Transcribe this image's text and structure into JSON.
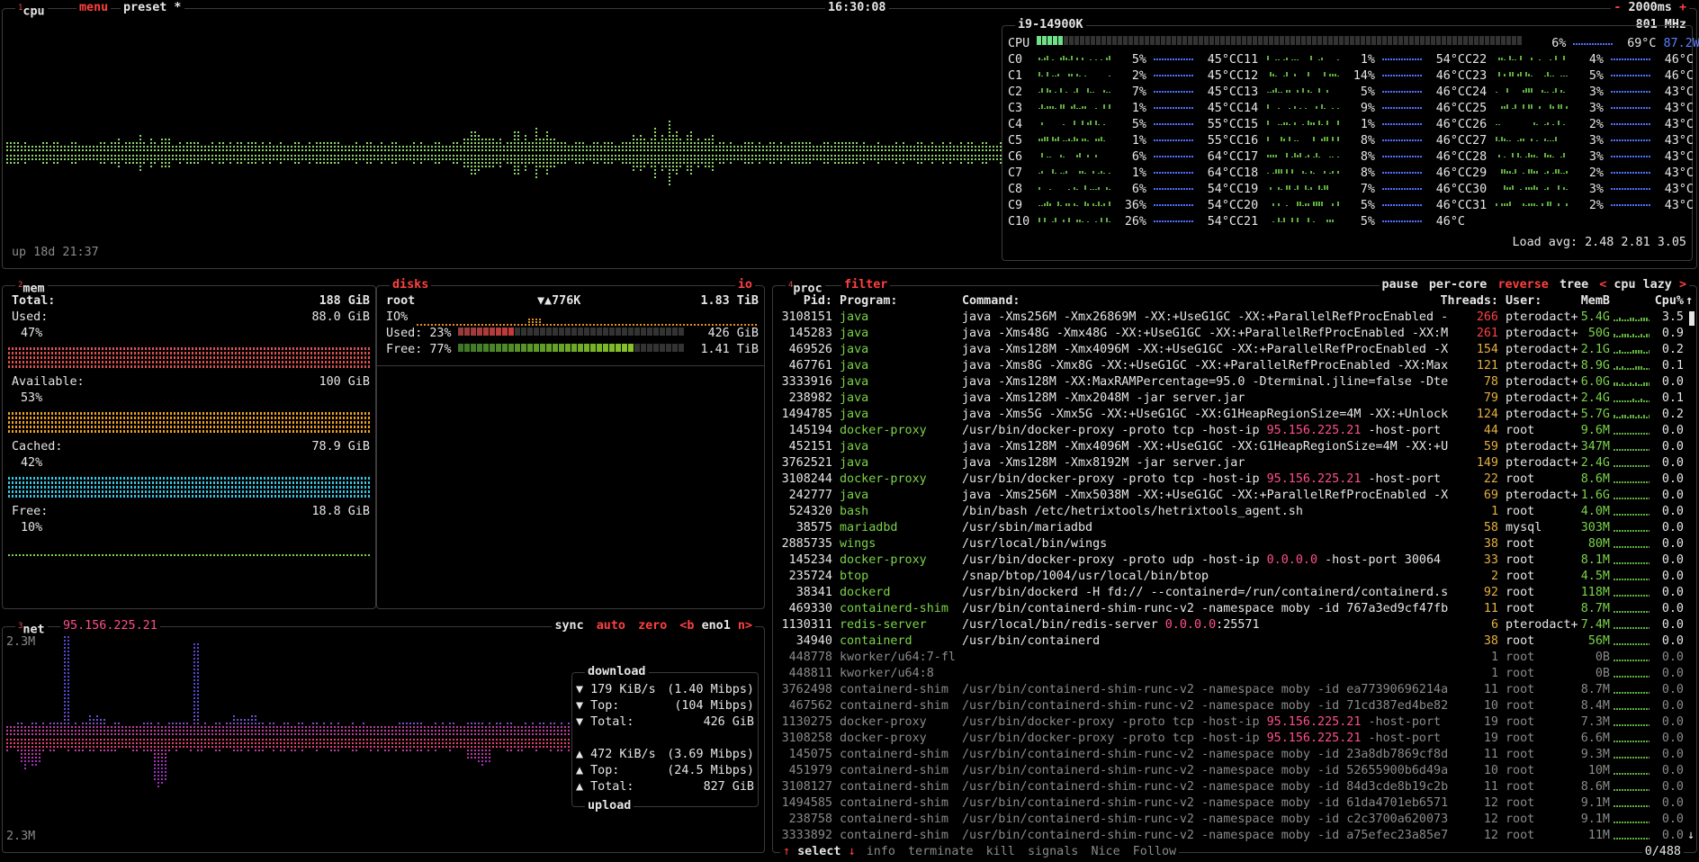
{
  "cpu": {
    "tab_num": "1",
    "tab_label": "cpu",
    "menu_label": "menu",
    "preset_label": "preset *",
    "clock": "16:30:08",
    "interval": "2000ms",
    "interval_minus": "-",
    "interval_plus": "+",
    "uptime": "up 18d 21:37",
    "model": "i9-14900K",
    "freq": "801 MHz",
    "total_label": "CPU",
    "total_pct": "6%",
    "total_temp": "69°C",
    "power": "87.2W",
    "load_avg_label": "Load avg:",
    "load_avg": "2.48 2.81 3.05",
    "cores": [
      {
        "n": "C0",
        "p": "5%",
        "t": "45°C"
      },
      {
        "n": "C1",
        "p": "2%",
        "t": "45°C"
      },
      {
        "n": "C2",
        "p": "7%",
        "t": "45°C"
      },
      {
        "n": "C3",
        "p": "1%",
        "t": "45°C"
      },
      {
        "n": "C4",
        "p": "5%",
        "t": "55°C"
      },
      {
        "n": "C5",
        "p": "1%",
        "t": "55°C"
      },
      {
        "n": "C6",
        "p": "6%",
        "t": "64°C"
      },
      {
        "n": "C7",
        "p": "1%",
        "t": "64°C"
      },
      {
        "n": "C8",
        "p": "6%",
        "t": "54°C"
      },
      {
        "n": "C9",
        "p": "36%",
        "t": "54°C"
      },
      {
        "n": "C10",
        "p": "26%",
        "t": "54°C"
      },
      {
        "n": "C11",
        "p": "1%",
        "t": "54°C"
      },
      {
        "n": "C12",
        "p": "14%",
        "t": "46°C"
      },
      {
        "n": "C13",
        "p": "5%",
        "t": "46°C"
      },
      {
        "n": "C14",
        "p": "9%",
        "t": "46°C"
      },
      {
        "n": "C15",
        "p": "1%",
        "t": "46°C"
      },
      {
        "n": "C16",
        "p": "8%",
        "t": "46°C"
      },
      {
        "n": "C17",
        "p": "8%",
        "t": "46°C"
      },
      {
        "n": "C18",
        "p": "8%",
        "t": "46°C"
      },
      {
        "n": "C19",
        "p": "7%",
        "t": "46°C"
      },
      {
        "n": "C20",
        "p": "5%",
        "t": "46°C"
      },
      {
        "n": "C21",
        "p": "5%",
        "t": "46°C"
      },
      {
        "n": "C22",
        "p": "4%",
        "t": "46°C"
      },
      {
        "n": "C23",
        "p": "5%",
        "t": "46°C"
      },
      {
        "n": "C24",
        "p": "3%",
        "t": "43°C"
      },
      {
        "n": "C25",
        "p": "3%",
        "t": "43°C"
      },
      {
        "n": "C26",
        "p": "2%",
        "t": "43°C"
      },
      {
        "n": "C27",
        "p": "3%",
        "t": "43°C"
      },
      {
        "n": "C28",
        "p": "3%",
        "t": "43°C"
      },
      {
        "n": "C29",
        "p": "2%",
        "t": "43°C"
      },
      {
        "n": "C30",
        "p": "3%",
        "t": "43°C"
      },
      {
        "n": "C31",
        "p": "2%",
        "t": "43°C"
      }
    ]
  },
  "mem": {
    "tab_num": "2",
    "tab_label": "mem",
    "total_label": "Total:",
    "total": "188 GiB",
    "used_label": "Used:",
    "used": "88.0 GiB",
    "used_pct": "47%",
    "avail_label": "Available:",
    "avail": "100 GiB",
    "avail_pct": "53%",
    "cached_label": "Cached:",
    "cached": "78.9 GiB",
    "cached_pct": "42%",
    "free_label": "Free:",
    "free": "18.8 GiB",
    "free_pct": "10%"
  },
  "disks": {
    "tab_label": "disks",
    "io_label": "io",
    "name": "root",
    "io_rate": "▼▲776K",
    "size": "1.83 TiB",
    "io_pct_label": "IO%",
    "used_label": "Used: 23%",
    "used": "426 GiB",
    "free_label": "Free: 77%",
    "free": "1.41 TiB",
    "used_frac": 0.23,
    "free_frac": 0.77
  },
  "net": {
    "tab_num": "3",
    "tab_label": "net",
    "ip": "95.156.225.21",
    "sync": "sync",
    "auto": "auto",
    "zero": "zero",
    "iface_prev": "<b",
    "iface": "eno1",
    "iface_next": "n>",
    "scale_top": "2.3M",
    "scale_bottom": "2.3M",
    "download_label": "download",
    "dl_rate": "179 KiB/s",
    "dl_mbps": "(1.40 Mibps)",
    "dl_top_label": "Top:",
    "dl_top": "(104 Mibps)",
    "dl_total_label": "Total:",
    "dl_total": "426 GiB",
    "ul_rate": "472 KiB/s",
    "ul_mbps": "(3.69 Mibps)",
    "ul_top_label": "Top:",
    "ul_top": "(24.5 Mibps)",
    "ul_total_label": "Total:",
    "ul_total": "827 GiB",
    "upload_label": "upload",
    "down_arrow": "▼",
    "up_arrow": "▲"
  },
  "proc": {
    "tab_num": "4",
    "tab_label": "proc",
    "filter_label": "filter",
    "pause_label": "pause",
    "percore_label": "per-core",
    "reverse_label": "reverse",
    "tree_label": "tree",
    "sort_prev": "<",
    "sort_label": "cpu lazy",
    "sort_next": ">",
    "headers": {
      "pid": "Pid:",
      "program": "Program:",
      "command": "Command:",
      "threads": "Threads:",
      "user": "User:",
      "mem": "MemB",
      "cpu": "Cpu%"
    },
    "rows": [
      {
        "pid": "3108151",
        "prog": "java",
        "cmd": "java -Xms256M -Xmx26869M -XX:+UseG1GC -XX:+ParallelRefProcEnabled -",
        "thr": "266",
        "user": "pterodact+",
        "mem": "5.4G",
        "cpu": "3.5",
        "hot": true
      },
      {
        "pid": "145283",
        "prog": "java",
        "cmd": "java -Xms48G -Xmx48G -XX:+UseG1GC -XX:+ParallelRefProcEnabled -XX:M",
        "thr": "261",
        "user": "pterodact+",
        "mem": "50G",
        "cpu": "0.9",
        "hot": true
      },
      {
        "pid": "469526",
        "prog": "java",
        "cmd": "java -Xms128M -Xmx4096M -XX:+UseG1GC -XX:+ParallelRefProcEnabled -X",
        "thr": "154",
        "user": "pterodact+",
        "mem": "2.1G",
        "cpu": "0.2"
      },
      {
        "pid": "467761",
        "prog": "java",
        "cmd": "java -Xms8G -Xmx8G -XX:+UseG1GC -XX:+ParallelRefProcEnabled -XX:Max",
        "thr": "121",
        "user": "pterodact+",
        "mem": "8.9G",
        "cpu": "0.1"
      },
      {
        "pid": "3333916",
        "prog": "java",
        "cmd": "java -Xms128M -XX:MaxRAMPercentage=95.0 -Dterminal.jline=false -Dte",
        "thr": "78",
        "user": "pterodact+",
        "mem": "6.0G",
        "cpu": "0.0"
      },
      {
        "pid": "238982",
        "prog": "java",
        "cmd": "java -Xms128M -Xmx2048M -jar server.jar",
        "thr": "79",
        "user": "pterodact+",
        "mem": "2.4G",
        "cpu": "0.1"
      },
      {
        "pid": "1494785",
        "prog": "java",
        "cmd": "java -Xms5G -Xmx5G -XX:+UseG1GC -XX:G1HeapRegionSize=4M -XX:+Unlock",
        "thr": "124",
        "user": "pterodact+",
        "mem": "5.7G",
        "cpu": "0.2"
      },
      {
        "pid": "145194",
        "prog": "docker-proxy",
        "cmd": "/usr/bin/docker-proxy -proto tcp -host-ip ",
        "ip": "95.156.225.21",
        "cmd2": " -host-port",
        "thr": "44",
        "user": "root",
        "mem": "9.6M",
        "cpu": "0.0"
      },
      {
        "pid": "452151",
        "prog": "java",
        "cmd": "java -Xms128M -Xmx4096M -XX:+UseG1GC -XX:G1HeapRegionSize=4M -XX:+U",
        "thr": "59",
        "user": "pterodact+",
        "mem": "347M",
        "cpu": "0.0"
      },
      {
        "pid": "3762521",
        "prog": "java",
        "cmd": "java -Xms128M -Xmx8192M -jar server.jar",
        "thr": "149",
        "user": "pterodact+",
        "mem": "2.4G",
        "cpu": "0.0"
      },
      {
        "pid": "3108244",
        "prog": "docker-proxy",
        "cmd": "/usr/bin/docker-proxy -proto tcp -host-ip ",
        "ip": "95.156.225.21",
        "cmd2": " -host-port",
        "thr": "22",
        "user": "root",
        "mem": "8.6M",
        "cpu": "0.0"
      },
      {
        "pid": "242777",
        "prog": "java",
        "cmd": "java -Xms256M -Xmx5038M -XX:+UseG1GC -XX:+ParallelRefProcEnabled -X",
        "thr": "69",
        "user": "pterodact+",
        "mem": "1.6G",
        "cpu": "0.0"
      },
      {
        "pid": "524320",
        "prog": "bash",
        "cmd": "/bin/bash /etc/hetrixtools/hetrixtools_agent.sh",
        "thr": "1",
        "user": "root",
        "mem": "4.0M",
        "cpu": "0.0"
      },
      {
        "pid": "38575",
        "prog": "mariadbd",
        "cmd": "/usr/sbin/mariadbd",
        "thr": "58",
        "user": "mysql",
        "mem": "303M",
        "cpu": "0.0"
      },
      {
        "pid": "2885735",
        "prog": "wings",
        "cmd": "/usr/local/bin/wings",
        "thr": "38",
        "user": "root",
        "mem": "80M",
        "cpu": "0.0"
      },
      {
        "pid": "145234",
        "prog": "docker-proxy",
        "cmd": "/usr/bin/docker-proxy -proto udp -host-ip ",
        "ip": "0.0.0.0",
        "cmd2": " -host-port 30064",
        "thr": "33",
        "user": "root",
        "mem": "8.1M",
        "cpu": "0.0"
      },
      {
        "pid": "235724",
        "prog": "btop",
        "cmd": "/snap/btop/1004/usr/local/bin/btop",
        "thr": "2",
        "user": "root",
        "mem": "4.5M",
        "cpu": "0.0"
      },
      {
        "pid": "38341",
        "prog": "dockerd",
        "cmd": "/usr/bin/dockerd -H fd:// --containerd=/run/containerd/containerd.s",
        "thr": "92",
        "user": "root",
        "mem": "118M",
        "cpu": "0.0"
      },
      {
        "pid": "469330",
        "prog": "containerd-shim",
        "cmd": "/usr/bin/containerd-shim-runc-v2 -namespace moby -id 767a3ed9cf47fb",
        "thr": "11",
        "user": "root",
        "mem": "8.7M",
        "cpu": "0.0"
      },
      {
        "pid": "1130311",
        "prog": "redis-server",
        "cmd": "/usr/local/bin/redis-server ",
        "ip": "0.0.0.0",
        "cmd2": ":25571",
        "thr": "6",
        "user": "pterodact+",
        "mem": "7.4M",
        "cpu": "0.0"
      },
      {
        "pid": "34940",
        "prog": "containerd",
        "cmd": "/usr/bin/containerd",
        "thr": "38",
        "user": "root",
        "mem": "56M",
        "cpu": "0.0"
      },
      {
        "pid": "448778",
        "prog": "kworker/u64:7-fl",
        "cmd": "",
        "thr": "1",
        "user": "root",
        "mem": "0B",
        "cpu": "0.0",
        "dim": true
      },
      {
        "pid": "448811",
        "prog": "kworker/u64:8",
        "cmd": "",
        "thr": "1",
        "user": "root",
        "mem": "0B",
        "cpu": "0.0",
        "dim": true
      },
      {
        "pid": "3762498",
        "prog": "containerd-shim",
        "cmd": "/usr/bin/containerd-shim-runc-v2 -namespace moby -id ea77390696214a",
        "thr": "11",
        "user": "root",
        "mem": "8.7M",
        "cpu": "0.0",
        "dim": true
      },
      {
        "pid": "467562",
        "prog": "containerd-shim",
        "cmd": "/usr/bin/containerd-shim-runc-v2 -namespace moby -id 71cd387ed4be82",
        "thr": "10",
        "user": "root",
        "mem": "8.4M",
        "cpu": "0.0",
        "dim": true
      },
      {
        "pid": "1130275",
        "prog": "docker-proxy",
        "cmd": "/usr/bin/docker-proxy -proto tcp -host-ip ",
        "ip": "95.156.225.21",
        "cmd2": " -host-port",
        "thr": "19",
        "user": "root",
        "mem": "7.3M",
        "cpu": "0.0",
        "dim": true
      },
      {
        "pid": "3108258",
        "prog": "docker-proxy",
        "cmd": "/usr/bin/docker-proxy -proto tcp -host-ip ",
        "ip": "95.156.225.21",
        "cmd2": " -host-port",
        "thr": "19",
        "user": "root",
        "mem": "6.6M",
        "cpu": "0.0",
        "dim": true
      },
      {
        "pid": "145075",
        "prog": "containerd-shim",
        "cmd": "/usr/bin/containerd-shim-runc-v2 -namespace moby -id 23a8db7869cf8d",
        "thr": "11",
        "user": "root",
        "mem": "9.3M",
        "cpu": "0.0",
        "dim": true
      },
      {
        "pid": "451979",
        "prog": "containerd-shim",
        "cmd": "/usr/bin/containerd-shim-runc-v2 -namespace moby -id 52655900b6d49a",
        "thr": "10",
        "user": "root",
        "mem": "10M",
        "cpu": "0.0",
        "dim": true
      },
      {
        "pid": "3108127",
        "prog": "containerd-shim",
        "cmd": "/usr/bin/containerd-shim-runc-v2 -namespace moby -id 84d3cde8b19c2b",
        "thr": "11",
        "user": "root",
        "mem": "8.6M",
        "cpu": "0.0",
        "dim": true
      },
      {
        "pid": "1494585",
        "prog": "containerd-shim",
        "cmd": "/usr/bin/containerd-shim-runc-v2 -namespace moby -id 61da4701eb6571",
        "thr": "12",
        "user": "root",
        "mem": "9.1M",
        "cpu": "0.0",
        "dim": true
      },
      {
        "pid": "238758",
        "prog": "containerd-shim",
        "cmd": "/usr/bin/containerd-shim-runc-v2 -namespace moby -id c2c3700a620073",
        "thr": "12",
        "user": "root",
        "mem": "9.1M",
        "cpu": "0.0",
        "dim": true
      },
      {
        "pid": "3333892",
        "prog": "containerd-shim",
        "cmd": "/usr/bin/containerd-shim-runc-v2 -namespace moby -id a75efec23a85e7",
        "thr": "12",
        "user": "root",
        "mem": "11M",
        "cpu": "0.0",
        "dim": true
      }
    ],
    "footer": {
      "select": "select",
      "info": "info",
      "terminate": "terminate",
      "kill": "kill",
      "signals": "signals",
      "nice": "Nice",
      "follow": "Follow",
      "count": "0/488"
    }
  },
  "colors": {
    "accent": "#e05050",
    "green": "#7bd44a",
    "blue": "#5b7fff",
    "pink": "#ff4f8b",
    "cyan": "#35c8e6"
  }
}
